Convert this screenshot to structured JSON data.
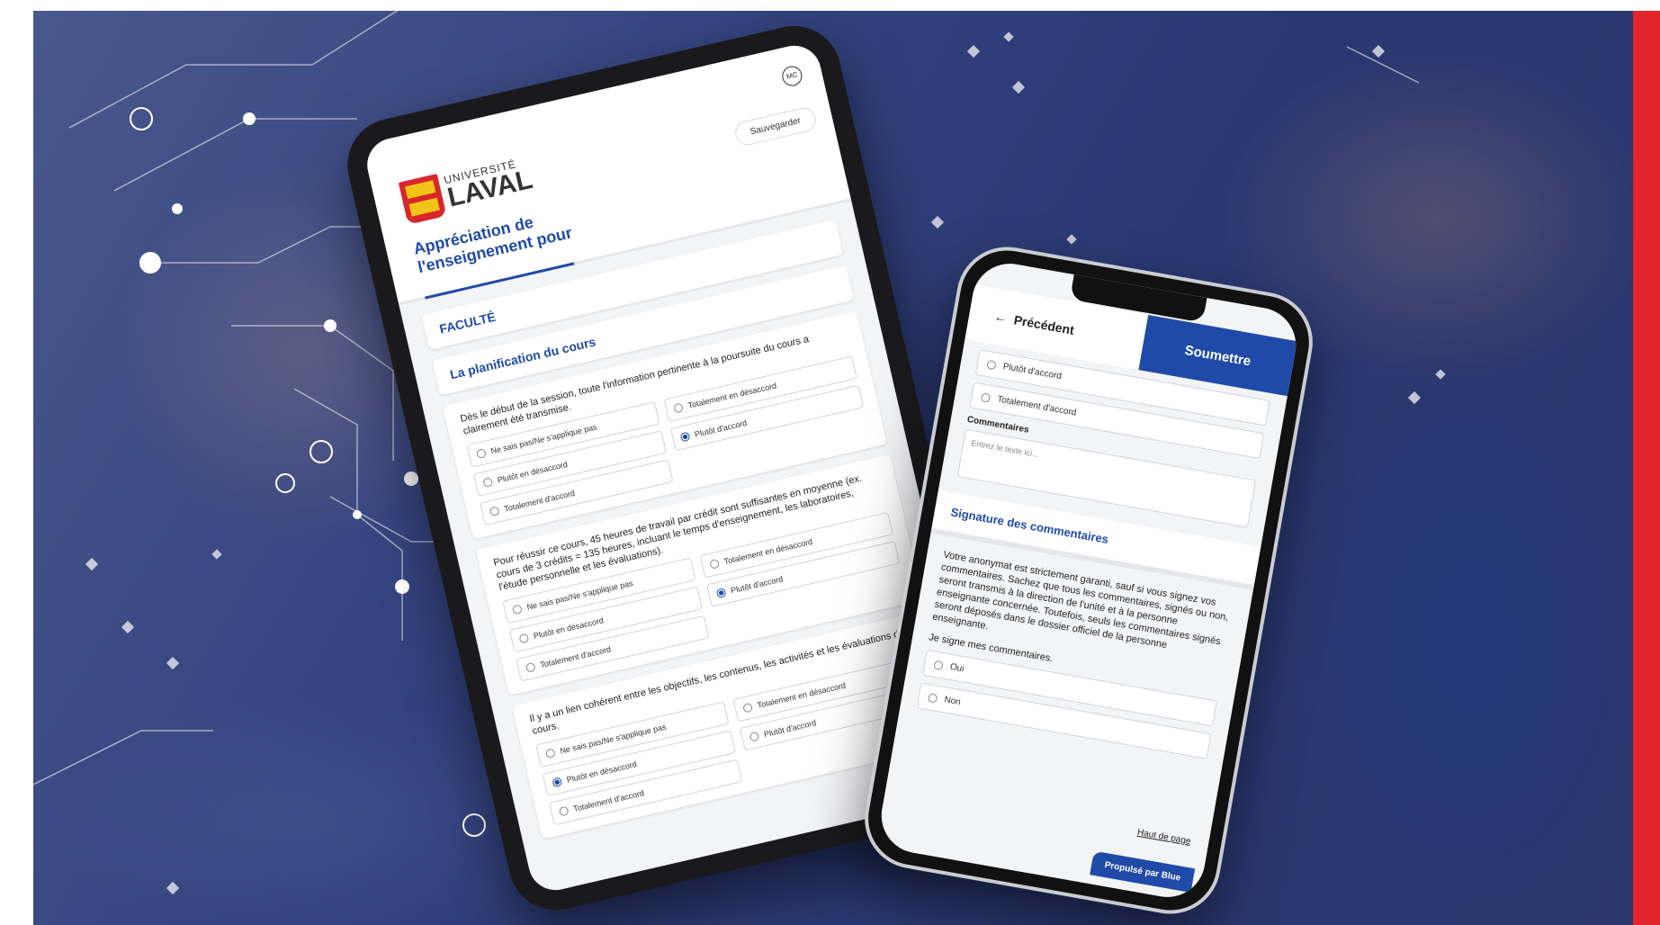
{
  "colors": {
    "accent": "#1f4aa8",
    "brand_red": "#e4252b"
  },
  "tablet": {
    "avatar": "MC",
    "logo": {
      "line1": "UNIVERSITÉ",
      "line2": "LAVAL"
    },
    "save_label": "Sauvegarder",
    "title": "Appréciation de l'enseignement pour",
    "faculty_label": "FACULTÉ",
    "section_title": "La planification du cours",
    "questions": [
      {
        "text": "Dès le début de la session, toute l'information pertinente à la poursuite du cours a clairement été transmise.",
        "options": [
          {
            "label": "Ne sais pas/Ne s'applique pas",
            "selected": false
          },
          {
            "label": "Totalement en désaccord",
            "selected": false
          },
          {
            "label": "Plutôt en désaccord",
            "selected": false
          },
          {
            "label": "Plutôt d'accord",
            "selected": true
          },
          {
            "label": "Totalement d'accord",
            "selected": false
          }
        ]
      },
      {
        "text": "Pour réussir ce cours, 45 heures de travail par crédit sont suffisantes en moyenne (ex. cours de 3 crédits = 135 heures, incluant le temps d'enseignement, les laboratoires, l'étude personnelle et les évaluations).",
        "options": [
          {
            "label": "Ne sais pas/Ne s'applique pas",
            "selected": false
          },
          {
            "label": "Totalement en désaccord",
            "selected": false
          },
          {
            "label": "Plutôt en désaccord",
            "selected": false
          },
          {
            "label": "Plutôt d'accord",
            "selected": true
          },
          {
            "label": "Totalement d'accord",
            "selected": false
          }
        ]
      },
      {
        "text": "Il y a un lien cohérent entre les objectifs, les contenus, les activités et les évaluations du cours.",
        "options": [
          {
            "label": "Ne sais pas/Ne s'applique pas",
            "selected": false
          },
          {
            "label": "Totalement en désaccord",
            "selected": false
          },
          {
            "label": "Plutôt en désaccord",
            "selected": true
          },
          {
            "label": "Plutôt d'accord",
            "selected": false
          },
          {
            "label": "Totalement d'accord",
            "selected": false
          }
        ]
      }
    ]
  },
  "phone": {
    "back_label": "Précédent",
    "submit_label": "Soumettre",
    "options_top": [
      "Plutôt d'accord",
      "Totalement d'accord"
    ],
    "comments_label": "Commentaires",
    "comments_placeholder": "Entrez le texte ici...",
    "signature_title": "Signature des commentaires",
    "signature_text": "Votre anonymat est strictement garanti, sauf si vous signez vos commentaires. Sachez que tous les commentaires, signés ou non, seront transmis à la direction de l'unité et à la personne enseignante concernée. Toutefois, seuls les commentaires signés seront déposés dans le dossier officiel de la personne enseignante.",
    "signature_question": "Je signe mes commentaires.",
    "yes_label": "Oui",
    "no_label": "Non",
    "top_link": "Haut de page",
    "powered_by": "Propulsé par Blue"
  }
}
